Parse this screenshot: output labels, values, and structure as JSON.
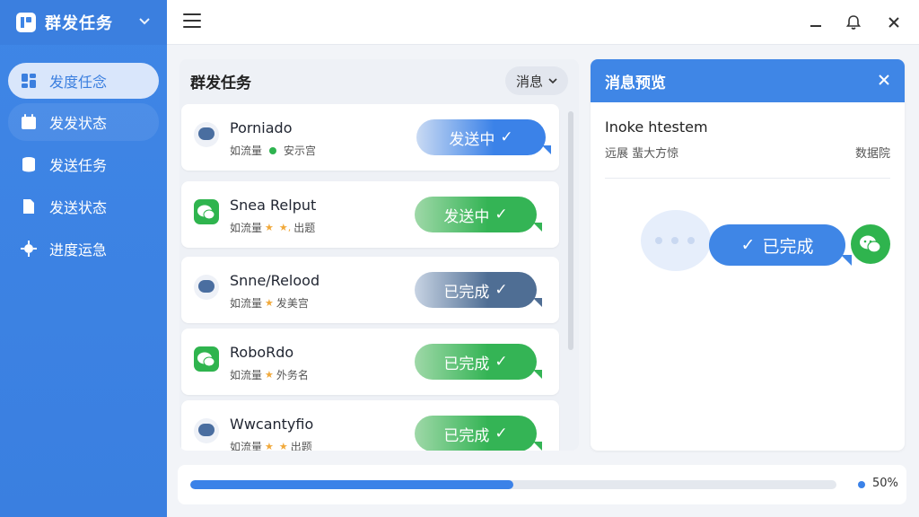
{
  "app": {
    "title": "群发任务",
    "brand_color": "#3f86e6"
  },
  "sidebar": {
    "items": [
      {
        "label": "发度任念",
        "icon": "dashboard-icon",
        "active": true
      },
      {
        "label": "发发状态",
        "icon": "calendar-icon"
      },
      {
        "label": "发送任务",
        "icon": "database-icon"
      },
      {
        "label": "发送状态",
        "icon": "document-icon"
      },
      {
        "label": "进度运急",
        "icon": "gear-icon"
      }
    ]
  },
  "task_panel": {
    "title": "群发任务",
    "filter_label": "消息",
    "tasks": [
      {
        "name": "Porniado",
        "meta_a": "如流量",
        "meta_b": "安示宫",
        "marker": "green-dot",
        "icon": "message-icon",
        "status": "发送中",
        "style": "blue"
      },
      {
        "name": "Snea Relput",
        "meta_a": "如流量",
        "meta_b": "出题",
        "marker": "stars",
        "icon": "wechat-icon",
        "status": "发送中",
        "style": "green"
      },
      {
        "name": "Snne/Relood",
        "meta_a": "如流量",
        "meta_b": "发美宫",
        "marker": "star",
        "icon": "message-icon",
        "status": "已完成",
        "style": "navy"
      },
      {
        "name": "RoboRdo",
        "meta_a": "如流量",
        "meta_b": "外务名",
        "marker": "star",
        "icon": "wechat-icon",
        "status": "已完成",
        "style": "green"
      },
      {
        "name": "Wwcantyfio",
        "meta_a": "如流量",
        "meta_b": "出题",
        "marker": "stars",
        "icon": "message-icon",
        "status": "已完成",
        "style": "green"
      }
    ]
  },
  "preview": {
    "title": "消息预览",
    "message_title": "Inoke htestem",
    "message_sub": "远展 蜚大方惊",
    "message_tag": "数据院",
    "bubble_text": "已完成"
  },
  "progress": {
    "value": 0.5,
    "label": "50%"
  }
}
